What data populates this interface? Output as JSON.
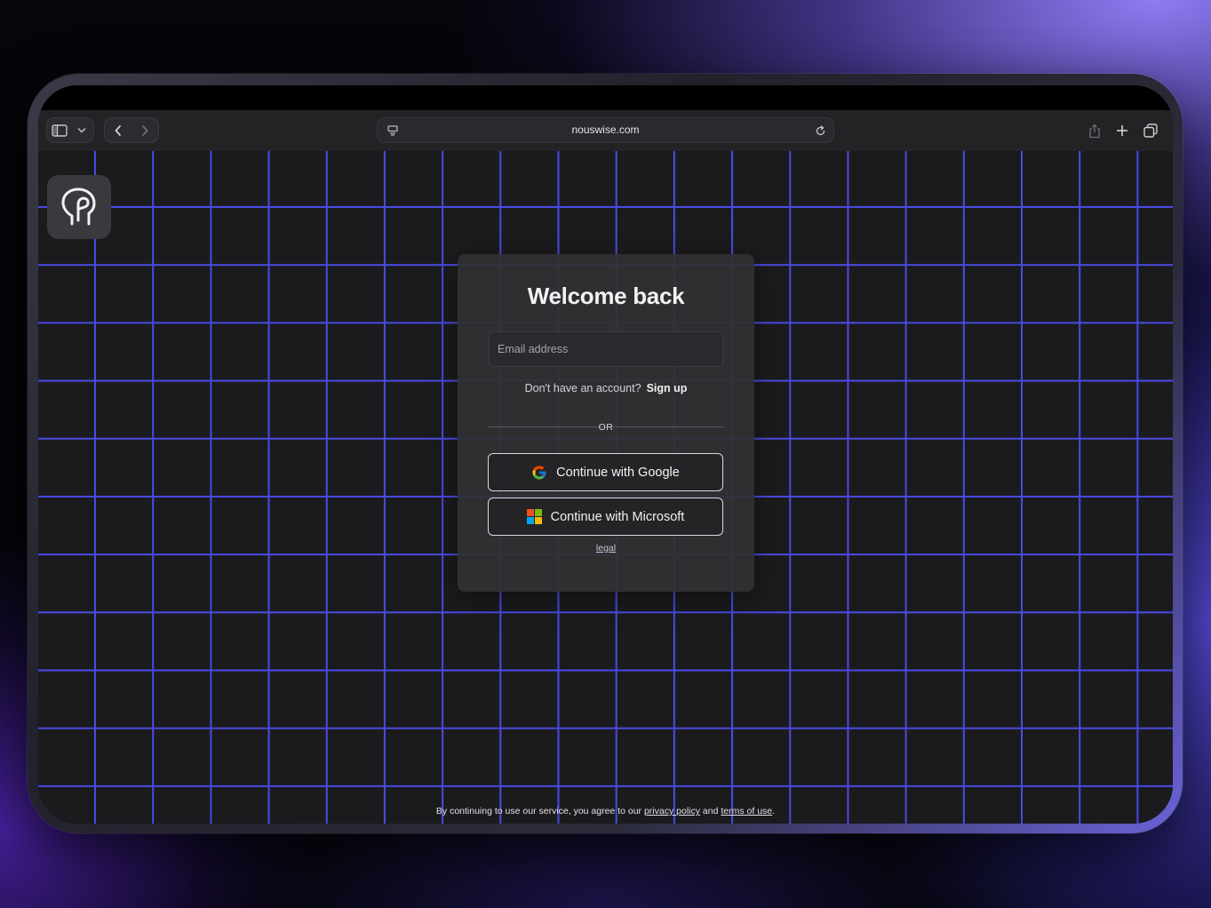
{
  "browser": {
    "url": "nouswise.com",
    "icons": {
      "sidebar": "sidebar-toggle-icon",
      "sidebar_menu": "chevron-down-icon",
      "back": "chevron-left-icon",
      "forward": "chevron-right-icon",
      "page_settings": "page-menu-icon",
      "reload": "reload-icon",
      "share": "share-icon",
      "new_tab": "plus-icon",
      "tabs": "tab-overview-icon"
    }
  },
  "login": {
    "title": "Welcome back",
    "email_placeholder": "Email address",
    "no_account_text": "Don't have an account?",
    "signup_label": "Sign up",
    "or_label": "OR",
    "google_label": "Continue with Google",
    "microsoft_label": "Continue with Microsoft",
    "legal_label": "legal"
  },
  "footer": {
    "prefix": "By continuing to use our service, you agree to our",
    "privacy_label": "privacy policy",
    "and": "and",
    "terms_label": "terms of use",
    "suffix": "."
  },
  "colors": {
    "grid_line": "#4a4ae6",
    "page_bg": "#1b1b1e",
    "card_bg": "#303034",
    "microsoft": [
      "#f25022",
      "#7fba00",
      "#00a4ef",
      "#ffb900"
    ]
  }
}
